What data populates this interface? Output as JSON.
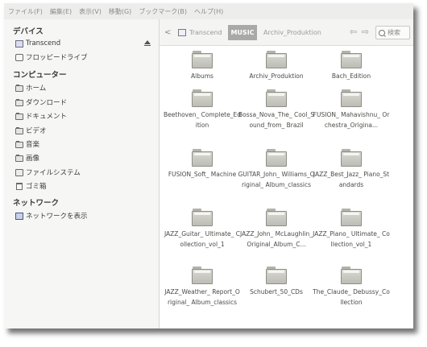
{
  "menubar": [
    "ファイル(F)",
    "編集(E)",
    "表示(V)",
    "移動(G)",
    "ブックマーク(B)",
    "ヘルプ(H)"
  ],
  "sidebar": {
    "devices_header": "デバイス",
    "devices": [
      {
        "label": "Transcend",
        "icon": "usb-drive-icon"
      },
      {
        "label": "フロッピードライブ",
        "icon": "floppy-drive-icon"
      }
    ],
    "computer_header": "コンピューター",
    "places": [
      {
        "label": "ホーム",
        "icon": "home-folder-icon"
      },
      {
        "label": "ダウンロード",
        "icon": "downloads-folder-icon"
      },
      {
        "label": "ドキュメント",
        "icon": "documents-folder-icon"
      },
      {
        "label": "ビデオ",
        "icon": "videos-folder-icon"
      },
      {
        "label": "音楽",
        "icon": "music-folder-icon"
      },
      {
        "label": "画像",
        "icon": "pictures-folder-icon"
      },
      {
        "label": "ファイルシステム",
        "icon": "filesystem-icon"
      },
      {
        "label": "ゴミ箱",
        "icon": "trash-icon"
      }
    ],
    "network_header": "ネットワーク",
    "network": [
      {
        "label": "ネットワークを表示",
        "icon": "network-icon"
      }
    ]
  },
  "toolbar": {
    "back_glyph": "<",
    "path": [
      "Transcend",
      "MUSIC",
      "Archiv_Produktion"
    ],
    "nav_arrows": "⇦ ⇨",
    "search_placeholder": "検索"
  },
  "files": [
    "Albums",
    "Archiv_Produktion",
    "Bach_Edition",
    "Beethoven_ Complete_Edition",
    "Bossa_Nova_The_ Cool_Sound_from_ Brazil",
    "FUSION_ Mahavishnu_ Orchestra_Origina...",
    "FUSION_Soft_ Machine",
    "GUITAR_John_ Williams_Original_ Album_classics",
    "JAZZ_Best_Jazz_ Piano_Standards",
    "JAZZ_Guitar_ Ultimate_ Collection_vol_1",
    "JAZZ_John_ McLaughlin_ Original_Album_C...",
    "JAZZ_Piano_ Ultimate_ Collection_vol_1",
    "JAZZ_Weather_ Report_Original_ Album_classics",
    "Schubert_50_CDs",
    "The_Claude_ Debussy_Collection"
  ]
}
